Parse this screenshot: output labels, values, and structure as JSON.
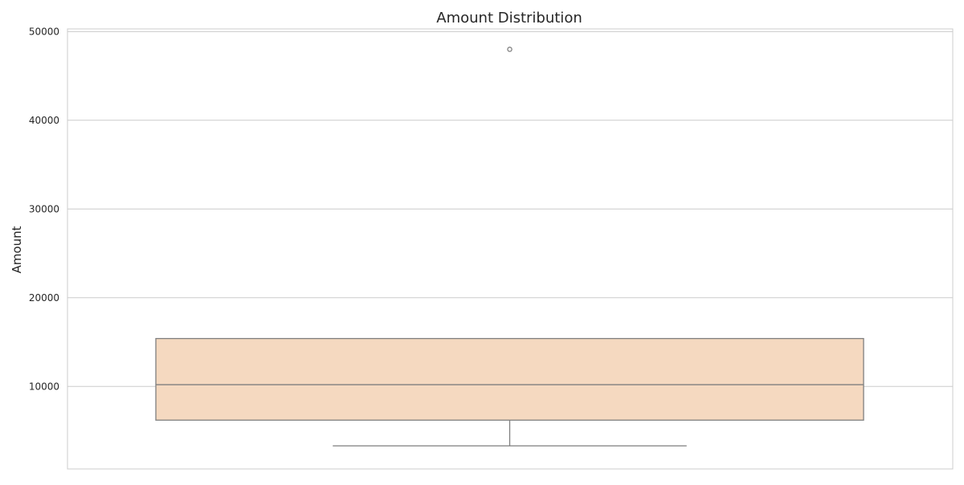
{
  "chart_data": {
    "type": "box",
    "title": "Amount Distribution",
    "xlabel": "",
    "ylabel": "Amount",
    "ylim": [
      700,
      50300
    ],
    "yticks": [
      10000,
      20000,
      30000,
      40000,
      50000
    ],
    "grid": true,
    "box": {
      "whisker_low": 3300,
      "q1": 6200,
      "median": 10200,
      "q3": 15400,
      "whisker_high": 15400,
      "outliers": [
        48000
      ]
    },
    "colors": {
      "box_fill": "#F5D9C0",
      "line": "#7F7F7F",
      "grid": "#CCCCCC",
      "spine": "#CCCCCC"
    }
  }
}
